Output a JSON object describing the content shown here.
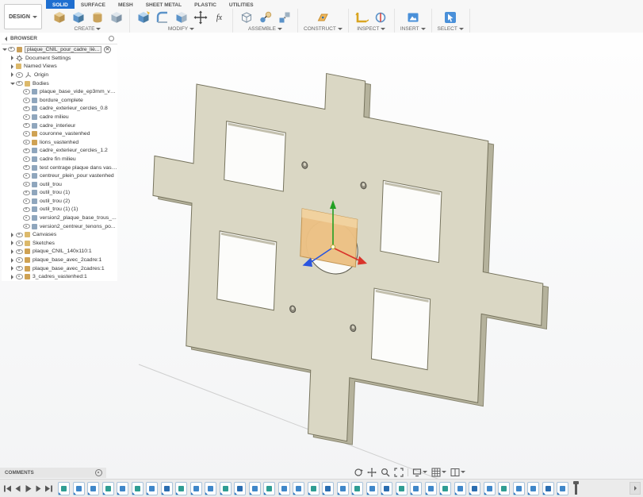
{
  "header": {
    "workspace": {
      "label": "DESIGN"
    },
    "tabs": [
      {
        "label": "SOLID",
        "active": true
      },
      {
        "label": "SURFACE",
        "active": false
      },
      {
        "label": "MESH",
        "active": false
      },
      {
        "label": "SHEET METAL",
        "active": false
      },
      {
        "label": "PLASTIC",
        "active": false
      },
      {
        "label": "UTILITIES",
        "active": false
      }
    ],
    "groups": [
      "CREATE",
      "MODIFY",
      "ASSEMBLE",
      "CONSTRUCT",
      "INSPECT",
      "INSERT",
      "SELECT"
    ],
    "fx_label": "fx"
  },
  "browser": {
    "panel_title": "BROWSER",
    "document": {
      "label": "plaque_CNIL_pour_cadre_liè..."
    },
    "top_rows": [
      {
        "label": "Document Settings"
      },
      {
        "label": "Named Views"
      },
      {
        "label": "Origin"
      },
      {
        "label": "Bodies"
      }
    ],
    "bodies": [
      {
        "label": "plaque_base_vide_ep3mm_va...",
        "color": "#8fa6bd"
      },
      {
        "label": "bordure_complete",
        "color": "#8fa6bd"
      },
      {
        "label": "cadre_exterieur_cercles_0.8",
        "color": "#8fa6bd"
      },
      {
        "label": "cadre milieu",
        "color": "#8fa6bd"
      },
      {
        "label": "cadre_interieur",
        "color": "#8fa6bd"
      },
      {
        "label": "couronne_vastenhed",
        "color": "#cfa254"
      },
      {
        "label": "lions_vastenhed",
        "color": "#cfa254"
      },
      {
        "label": "cadre_exterieur_cercles_1.2",
        "color": "#8fa6bd"
      },
      {
        "label": "cadre fin milieu",
        "color": "#8fa6bd"
      },
      {
        "label": "test centrage plaque dans vast...",
        "color": "#8fa6bd"
      },
      {
        "label": "centreur_plein_pour vastenhed",
        "color": "#8fa6bd"
      },
      {
        "label": "outil_trou",
        "color": "#8fa6bd"
      },
      {
        "label": "outil_trou (1)",
        "color": "#8fa6bd"
      },
      {
        "label": "outil_trou (2)",
        "color": "#8fa6bd"
      },
      {
        "label": "outil_trou (1) (1)",
        "color": "#8fa6bd"
      },
      {
        "label": "version2_plaque_base_trous_...",
        "color": "#8fa6bd"
      },
      {
        "label": "version2_centreur_tenons_po...",
        "color": "#8fa6bd"
      }
    ],
    "mid_rows": [
      {
        "label": "Canvases"
      },
      {
        "label": "Sketches"
      }
    ],
    "components": [
      {
        "label": "plaque_CNIL_140x110:1",
        "color": "#cfa254"
      },
      {
        "label": "plaque_base_avec_2cadre:1",
        "color": "#cfa254"
      },
      {
        "label": "plaque_base_avec_2cadres:1",
        "color": "#cfa254"
      },
      {
        "label": "3_cadres_vastenhed:1",
        "color": "#cfa254"
      }
    ]
  },
  "viewport": {
    "part_top_color": "#dad7c4",
    "part_side_color": "#b5b29c",
    "part_edge_color": "#76735d",
    "selection_box_color": "#ecc184",
    "axis_colors": {
      "x": "#d9342b",
      "y": "#22a022",
      "z": "#2a55e0"
    }
  },
  "navbar": {
    "items": [
      {
        "name": "orbit"
      },
      {
        "name": "pan"
      },
      {
        "name": "zoom"
      },
      {
        "name": "fit"
      },
      {
        "name": "display-settings"
      },
      {
        "name": "grid-settings"
      },
      {
        "name": "viewports"
      }
    ]
  },
  "comments": {
    "label": "COMMENTS"
  },
  "timeline": {
    "controls": [
      {
        "name": "go-to-start"
      },
      {
        "name": "step-back"
      },
      {
        "name": "play"
      },
      {
        "name": "step-forward"
      },
      {
        "name": "go-to-end"
      }
    ],
    "features": [
      {
        "name": "sketch",
        "color": "#2f9d93"
      },
      {
        "name": "extrude",
        "color": "#3f87c9"
      },
      {
        "name": "extrude",
        "color": "#3f87c9"
      },
      {
        "name": "sketch",
        "color": "#2f9d93"
      },
      {
        "name": "extrude",
        "color": "#3f87c9"
      },
      {
        "name": "sketch",
        "color": "#2f9d93"
      },
      {
        "name": "extrude",
        "color": "#3f87c9"
      },
      {
        "name": "combine",
        "color": "#2a6db0"
      },
      {
        "name": "sketch",
        "color": "#2f9d93"
      },
      {
        "name": "extrude",
        "color": "#3f87c9"
      },
      {
        "name": "extrude",
        "color": "#3f87c9"
      },
      {
        "name": "sketch",
        "color": "#2f9d93"
      },
      {
        "name": "mirror",
        "color": "#2a6db0"
      },
      {
        "name": "extrude",
        "color": "#3f87c9"
      },
      {
        "name": "sketch",
        "color": "#2f9d93"
      },
      {
        "name": "extrude",
        "color": "#3f87c9"
      },
      {
        "name": "extrude",
        "color": "#3f87c9"
      },
      {
        "name": "sketch",
        "color": "#2f9d93"
      },
      {
        "name": "hole",
        "color": "#2a6db0"
      },
      {
        "name": "extrude",
        "color": "#3f87c9"
      },
      {
        "name": "sketch",
        "color": "#2f9d93"
      },
      {
        "name": "extrude",
        "color": "#3f87c9"
      },
      {
        "name": "combine",
        "color": "#2a6db0"
      },
      {
        "name": "sketch",
        "color": "#2f9d93"
      },
      {
        "name": "extrude",
        "color": "#3f87c9"
      },
      {
        "name": "extrude",
        "color": "#3f87c9"
      },
      {
        "name": "sketch",
        "color": "#2f9d93"
      },
      {
        "name": "extrude",
        "color": "#3f87c9"
      },
      {
        "name": "mirror",
        "color": "#2a6db0"
      },
      {
        "name": "extrude",
        "color": "#3f87c9"
      },
      {
        "name": "sketch",
        "color": "#2f9d93"
      },
      {
        "name": "extrude",
        "color": "#3f87c9"
      },
      {
        "name": "extrude",
        "color": "#3f87c9"
      },
      {
        "name": "combine",
        "color": "#2a6db0"
      },
      {
        "name": "move",
        "color": "#3f87c9"
      }
    ]
  }
}
